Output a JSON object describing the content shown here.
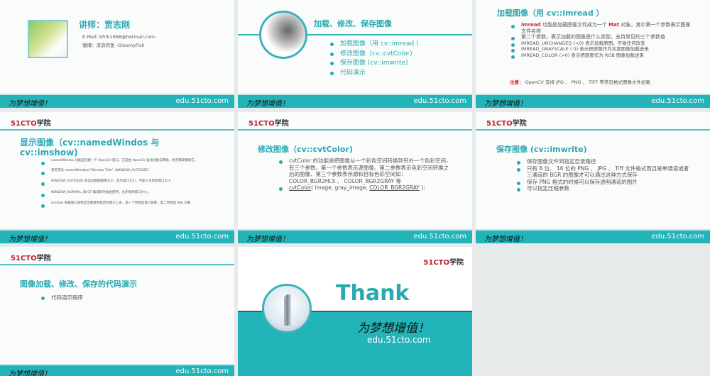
{
  "common": {
    "slogan": "为梦想增值！",
    "url": "edu.51cto.com",
    "logo_a": "51CTO",
    "logo_b": "学院"
  },
  "slide1": {
    "title": "讲师：贾志刚",
    "email": "E-Mail: bfnh1998@hotmail.com",
    "weibo": "微博：流浪的鱼 -GloomyFish"
  },
  "slide2": {
    "title": "加载、修改、保存图像",
    "items": [
      "加载图像（用 cv::imread ）",
      "修改图像（cv::cvtColor)",
      "保存图像 (cv::imwrite)",
      "代码演示"
    ]
  },
  "slide3": {
    "title": "加载图像（用 cv::imread ）",
    "items": [
      {
        "kw": "imread",
        "pre": " 功能是加载图像文件成为一个 ",
        "kw2": "Mat",
        "post": " 对象，其中第一个参数表示图像文件名称"
      },
      "第二个参数，表示加载的图像是什么类型，支持常见的三个参数值",
      "IMREAD_UNCHANGED (<0) 表示加载原图，不做任何改变",
      "IMREAD_GRAYSCALE ( 0) 表示把原图作为灰度图像加载进来",
      "IMREAD_COLOR (>0) 表示把原图作为 RGB 图像加载进来"
    ],
    "note_label": "注意：",
    "note": " OpenCV 支持 JPG 、 PNG 、 TIFF 等常见格式图像文件加载"
  },
  "slide4": {
    "title": "显示图像（cv::namedWindos 与 cv::imshow)",
    "items": [
      "namedWindos 功能是创建一个 OpenCV 窗口，它是由 OpenCV 自动创建与释放，你无需取销毁它。",
      "常见用法 namedWindow(\"Window Title\", WINDOW_AUTOSIZE)",
      "WINDOW_AUTOSIZE 会自动根据图像大小，显示窗口大小，不能人为改变窗口大小",
      "WINDOW_NORMAL, 跟 QT 集成的时候会使用，允许修改窗口大小。",
      "imshow 根据窗口名称显示图像到指定的窗口上去，第一个参数是窗口名称，第二参数是 Mat 对象"
    ]
  },
  "slide5": {
    "title": "修改图像（cv::cvtColor)",
    "item1": "cvtColor 的功能是把图像从一个彩色空间转换到另外一个色彩空间，有三个参数，第一个参数表示源图像、第二参数表示色彩空间转换之后的图像、第三个参数表示源和目标色彩空间如： COLOR_BGR2HLS 、 COLOR_BGR2GRAY 等",
    "code_fn": "cvtColor",
    "code_mid": "( image, gray_image, ",
    "code_const": "COLOR_BGR2GRAY",
    "code_end": " );"
  },
  "slide6": {
    "title": "保存图像 (cv::imwrite)",
    "items": [
      "保存图像文件到指定目录路径",
      "只有 8 位、 16 位的 PNG 、 JPG 、 Tiff 文件格式而且是单通道或者三通道的 BGR 的图像才可以通过这种方式保存",
      "保存 PNG 格式的时候可以保存透明通道的图片",
      "可以指定压缩参数"
    ]
  },
  "slide7": {
    "title": "图像加载、修改、保存的代码演示",
    "items": [
      "代码演示程序"
    ]
  },
  "slide8": {
    "title": "Thank"
  }
}
